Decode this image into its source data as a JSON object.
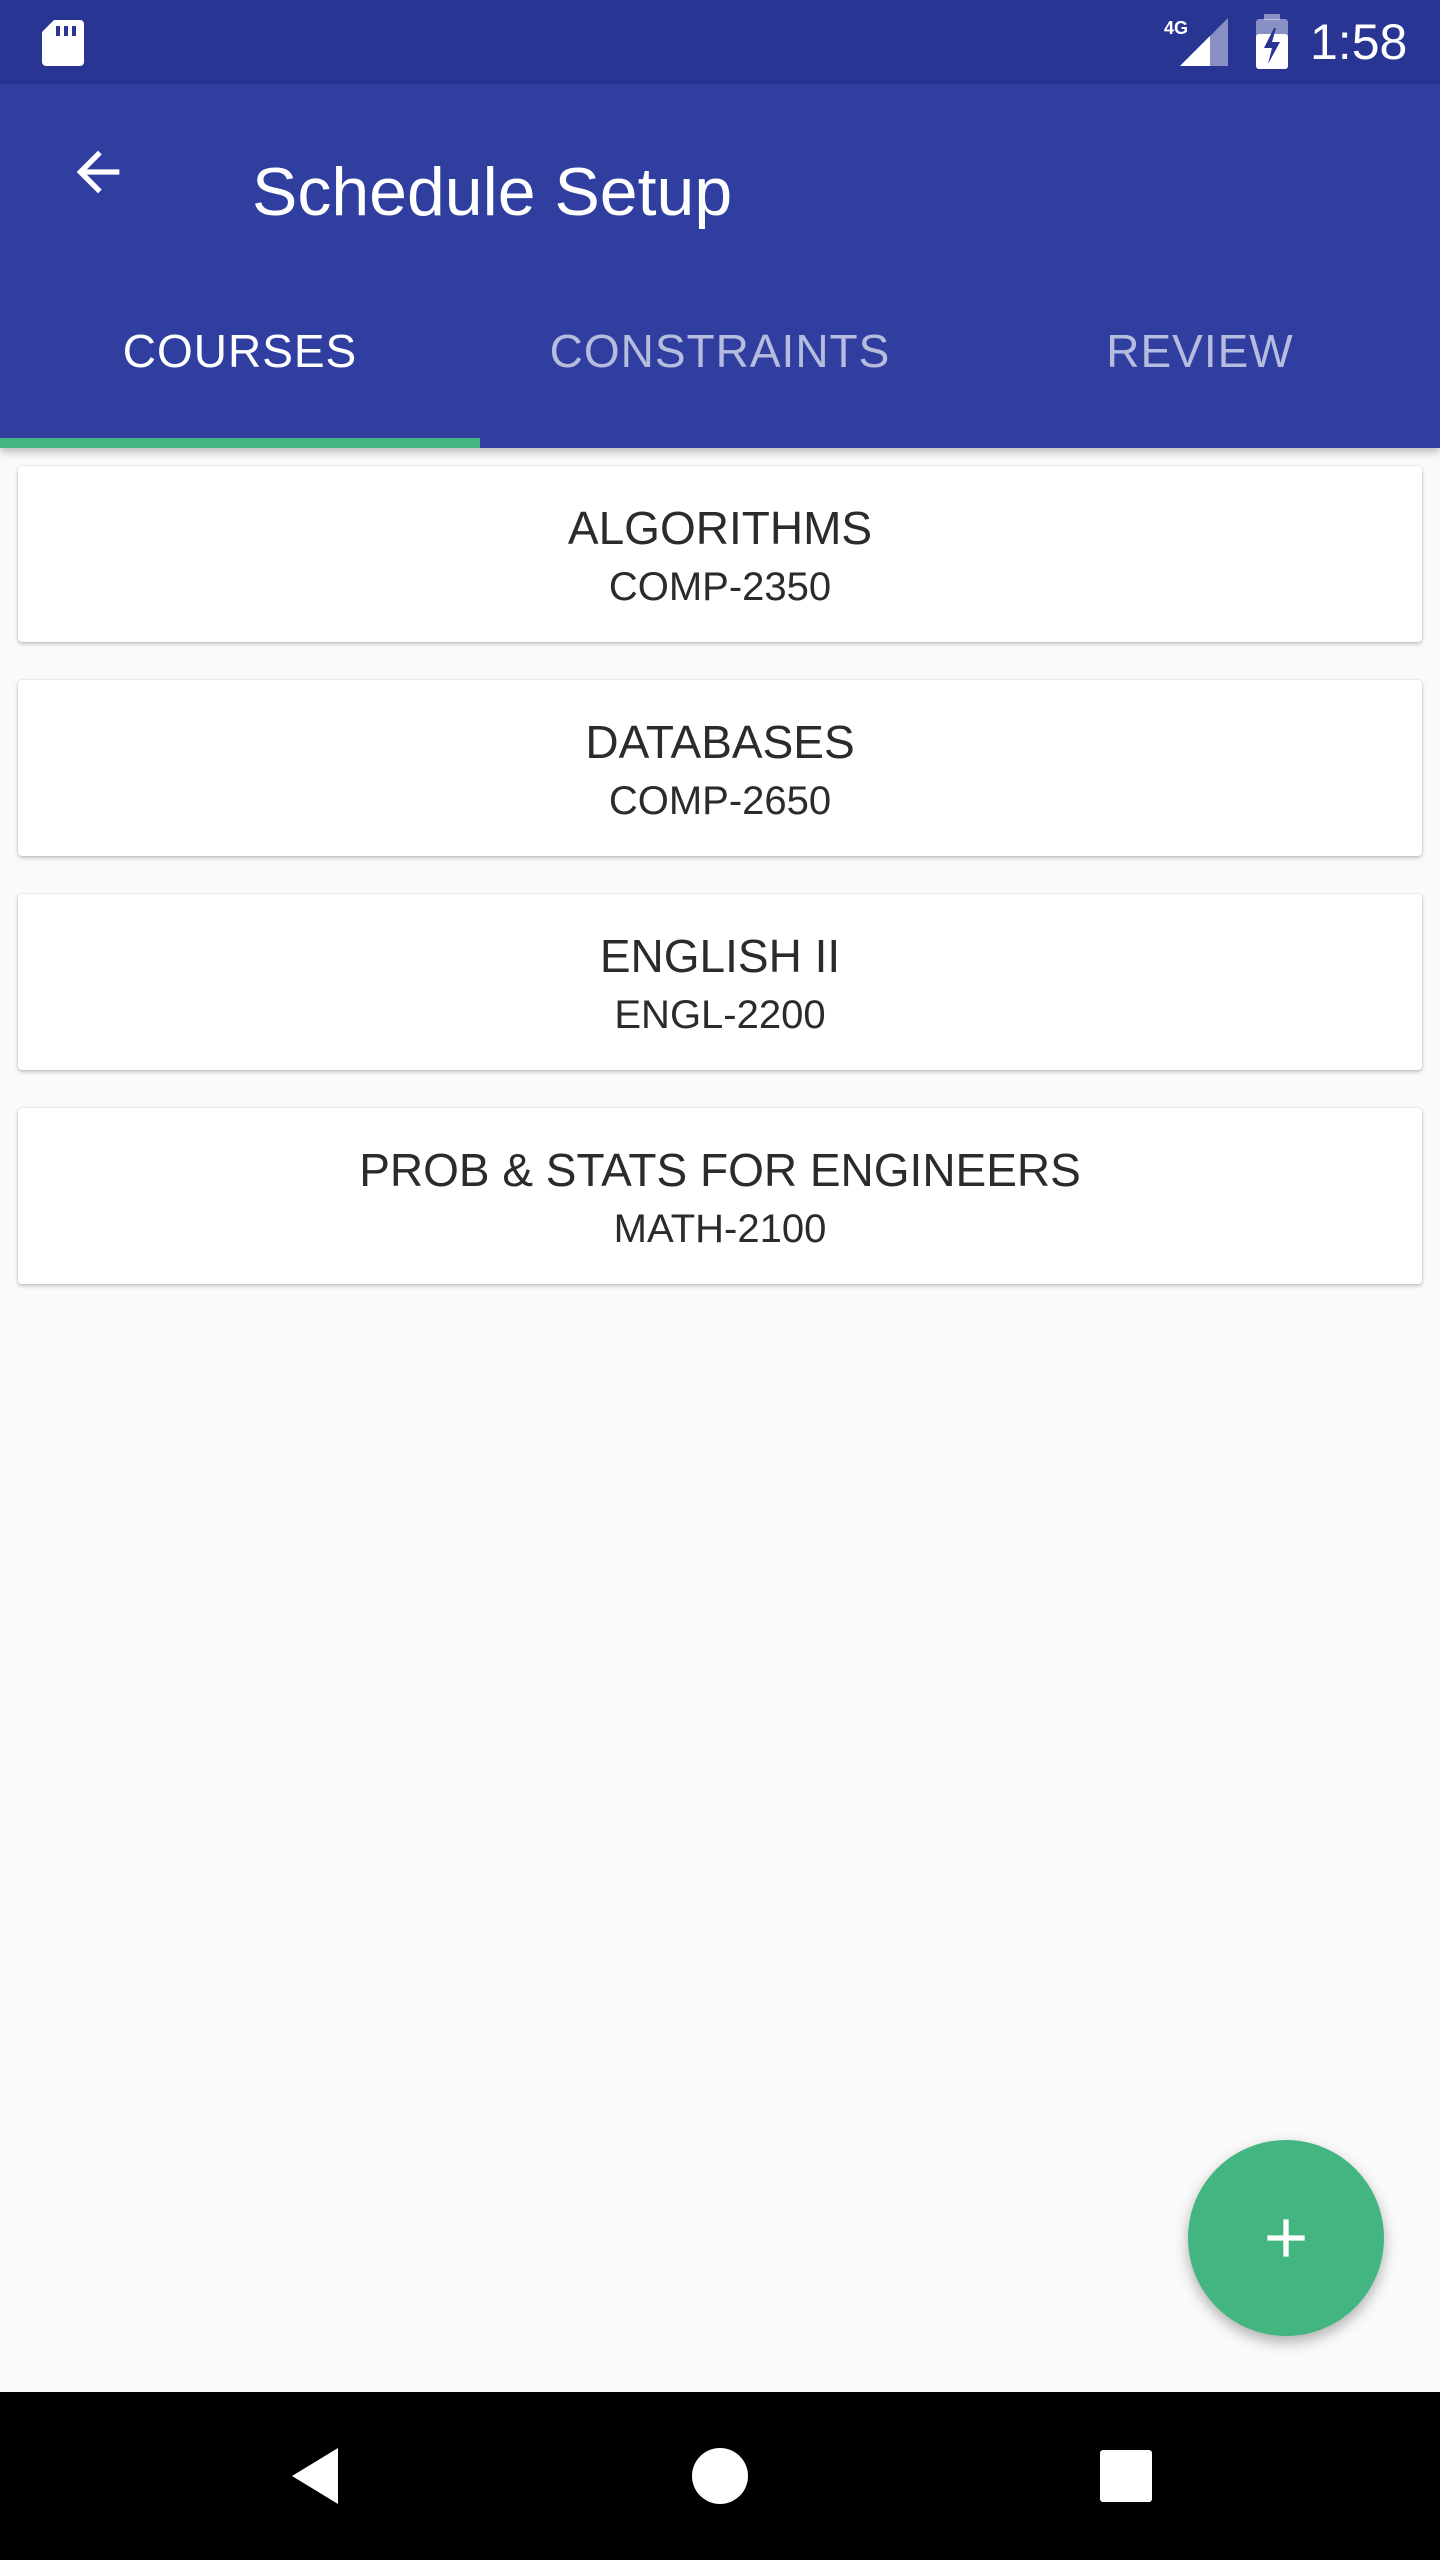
{
  "status_bar": {
    "network": "4G",
    "time": "1:58"
  },
  "app_bar": {
    "title": "Schedule Setup"
  },
  "tabs": [
    {
      "label": "COURSES",
      "active": true
    },
    {
      "label": "CONSTRAINTS",
      "active": false
    },
    {
      "label": "REVIEW",
      "active": false
    }
  ],
  "courses": [
    {
      "name": "ALGORITHMS",
      "code": "COMP-2350"
    },
    {
      "name": "DATABASES",
      "code": "COMP-2650"
    },
    {
      "name": "ENGLISH II",
      "code": "ENGL-2200"
    },
    {
      "name": "PROB & STATS FOR ENGINEERS",
      "code": "MATH-2100"
    }
  ],
  "colors": {
    "status_bar": "#283593",
    "app_bar": "#303f9f",
    "accent": "#43b581",
    "background": "#fafafa"
  },
  "icons": {
    "sd_card": "sd-card-icon",
    "signal": "signal-icon",
    "battery": "battery-charging-icon",
    "back": "arrow-back-icon",
    "add": "plus-icon",
    "nav_back": "triangle-back-icon",
    "nav_home": "circle-home-icon",
    "nav_recents": "square-recents-icon"
  }
}
